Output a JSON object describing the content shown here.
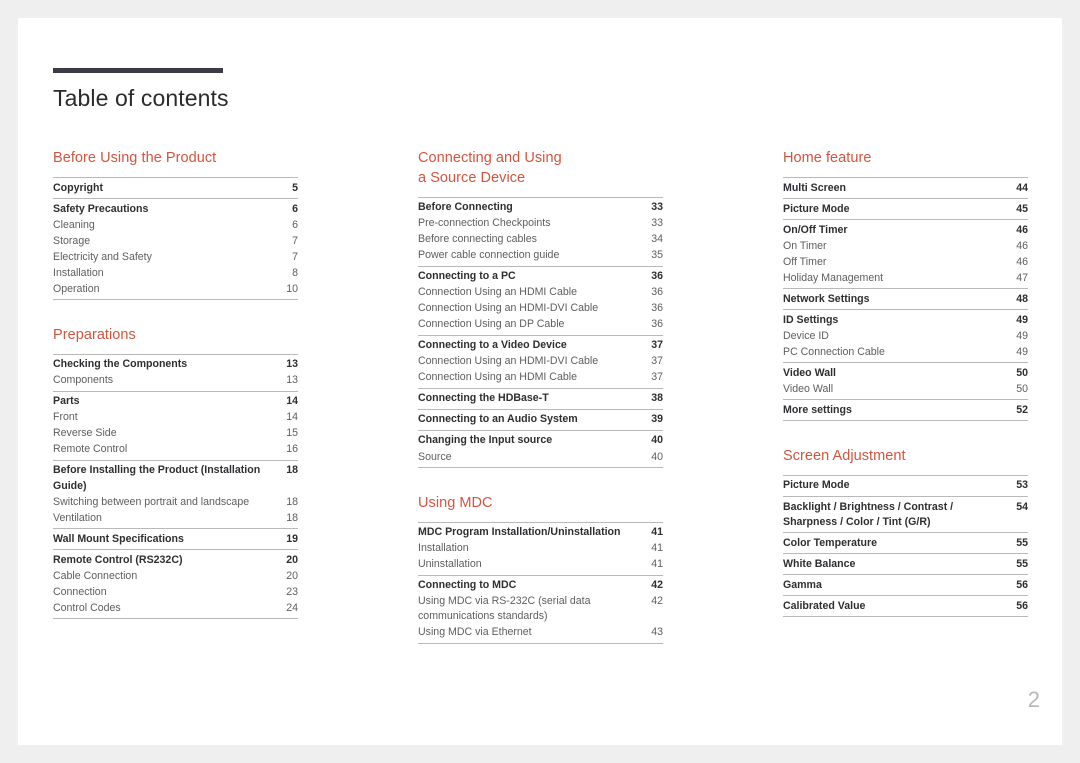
{
  "document": {
    "title": "Table of contents",
    "page_number": "2",
    "accent_color": "#cf5741",
    "rule_color": "#3c3c46"
  },
  "columns": [
    {
      "name": "left",
      "sections": [
        {
          "heading": [
            "Before Using the Product"
          ],
          "groups": [
            {
              "entries": [
                {
                  "label": "Copyright",
                  "page": "5",
                  "level": "main"
                }
              ]
            },
            {
              "entries": [
                {
                  "label": "Safety Precautions",
                  "page": "6",
                  "level": "main"
                },
                {
                  "label": "Cleaning",
                  "page": "6",
                  "level": "sub"
                },
                {
                  "label": "Storage",
                  "page": "7",
                  "level": "sub"
                },
                {
                  "label": "Electricity and Safety",
                  "page": "7",
                  "level": "sub"
                },
                {
                  "label": "Installation",
                  "page": "8",
                  "level": "sub"
                },
                {
                  "label": "Operation",
                  "page": "10",
                  "level": "sub"
                }
              ]
            }
          ]
        },
        {
          "heading": [
            "Preparations"
          ],
          "groups": [
            {
              "entries": [
                {
                  "label": "Checking the Components",
                  "page": "13",
                  "level": "main"
                },
                {
                  "label": "Components",
                  "page": "13",
                  "level": "sub"
                }
              ]
            },
            {
              "entries": [
                {
                  "label": "Parts",
                  "page": "14",
                  "level": "main"
                },
                {
                  "label": "Front",
                  "page": "14",
                  "level": "sub"
                },
                {
                  "label": "Reverse Side",
                  "page": "15",
                  "level": "sub"
                },
                {
                  "label": "Remote Control",
                  "page": "16",
                  "level": "sub"
                }
              ]
            },
            {
              "entries": [
                {
                  "label": "Before Installing the Product (Installation Guide)",
                  "page": "18",
                  "level": "main",
                  "wrap": true
                },
                {
                  "label": "Switching between portrait and landscape",
                  "page": "18",
                  "level": "sub"
                },
                {
                  "label": "Ventilation",
                  "page": "18",
                  "level": "sub"
                }
              ]
            },
            {
              "entries": [
                {
                  "label": "Wall Mount Specifications",
                  "page": "19",
                  "level": "main"
                }
              ]
            },
            {
              "entries": [
                {
                  "label": "Remote Control (RS232C)",
                  "page": "20",
                  "level": "main"
                },
                {
                  "label": "Cable Connection",
                  "page": "20",
                  "level": "sub"
                },
                {
                  "label": "Connection",
                  "page": "23",
                  "level": "sub"
                },
                {
                  "label": "Control Codes",
                  "page": "24",
                  "level": "sub"
                }
              ]
            }
          ]
        }
      ]
    },
    {
      "name": "middle",
      "sections": [
        {
          "heading": [
            "Connecting and Using",
            "a Source Device"
          ],
          "groups": [
            {
              "entries": [
                {
                  "label": "Before Connecting",
                  "page": "33",
                  "level": "main"
                },
                {
                  "label": "Pre-connection Checkpoints",
                  "page": "33",
                  "level": "sub"
                },
                {
                  "label": "Before connecting cables",
                  "page": "34",
                  "level": "sub"
                },
                {
                  "label": "Power cable connection guide",
                  "page": "35",
                  "level": "sub"
                }
              ]
            },
            {
              "entries": [
                {
                  "label": "Connecting to a PC",
                  "page": "36",
                  "level": "main"
                },
                {
                  "label": "Connection Using an HDMI Cable",
                  "page": "36",
                  "level": "sub"
                },
                {
                  "label": "Connection Using an HDMI-DVI Cable",
                  "page": "36",
                  "level": "sub"
                },
                {
                  "label": "Connection Using an DP Cable",
                  "page": "36",
                  "level": "sub"
                }
              ]
            },
            {
              "entries": [
                {
                  "label": "Connecting to a Video Device",
                  "page": "37",
                  "level": "main"
                },
                {
                  "label": "Connection Using an HDMI-DVI Cable",
                  "page": "37",
                  "level": "sub"
                },
                {
                  "label": "Connection Using an HDMI Cable",
                  "page": "37",
                  "level": "sub"
                }
              ]
            },
            {
              "entries": [
                {
                  "label": "Connecting the HDBase-T",
                  "page": "38",
                  "level": "main"
                }
              ]
            },
            {
              "entries": [
                {
                  "label": "Connecting to an Audio System",
                  "page": "39",
                  "level": "main"
                }
              ]
            },
            {
              "entries": [
                {
                  "label": "Changing the Input source",
                  "page": "40",
                  "level": "main"
                },
                {
                  "label": "Source",
                  "page": "40",
                  "level": "sub"
                }
              ]
            }
          ]
        },
        {
          "heading": [
            "Using MDC"
          ],
          "groups": [
            {
              "entries": [
                {
                  "label": "MDC Program Installation/Uninstallation",
                  "page": "41",
                  "level": "main"
                },
                {
                  "label": "Installation",
                  "page": "41",
                  "level": "sub"
                },
                {
                  "label": "Uninstallation",
                  "page": "41",
                  "level": "sub"
                }
              ]
            },
            {
              "entries": [
                {
                  "label": "Connecting to MDC",
                  "page": "42",
                  "level": "main"
                },
                {
                  "label": "Using MDC via RS-232C (serial data communications standards)",
                  "page": "42",
                  "level": "sub",
                  "wrap": true
                },
                {
                  "label": "Using MDC via Ethernet",
                  "page": "43",
                  "level": "sub"
                }
              ]
            }
          ]
        }
      ]
    },
    {
      "name": "right",
      "sections": [
        {
          "heading": [
            "Home feature"
          ],
          "groups": [
            {
              "entries": [
                {
                  "label": "Multi Screen",
                  "page": "44",
                  "level": "main"
                }
              ]
            },
            {
              "entries": [
                {
                  "label": "Picture Mode",
                  "page": "45",
                  "level": "main"
                }
              ]
            },
            {
              "entries": [
                {
                  "label": "On/Off Timer",
                  "page": "46",
                  "level": "main"
                },
                {
                  "label": "On Timer",
                  "page": "46",
                  "level": "sub"
                },
                {
                  "label": "Off Timer",
                  "page": "46",
                  "level": "sub"
                },
                {
                  "label": "Holiday Management",
                  "page": "47",
                  "level": "sub"
                }
              ]
            },
            {
              "entries": [
                {
                  "label": "Network Settings",
                  "page": "48",
                  "level": "main"
                }
              ]
            },
            {
              "entries": [
                {
                  "label": "ID Settings",
                  "page": "49",
                  "level": "main"
                },
                {
                  "label": "Device ID",
                  "page": "49",
                  "level": "sub"
                },
                {
                  "label": "PC Connection Cable",
                  "page": "49",
                  "level": "sub"
                }
              ]
            },
            {
              "entries": [
                {
                  "label": "Video Wall",
                  "page": "50",
                  "level": "main"
                },
                {
                  "label": "Video Wall",
                  "page": "50",
                  "level": "sub"
                }
              ]
            },
            {
              "entries": [
                {
                  "label": "More settings",
                  "page": "52",
                  "level": "main"
                }
              ]
            }
          ]
        },
        {
          "heading": [
            "Screen Adjustment"
          ],
          "groups": [
            {
              "entries": [
                {
                  "label": "Picture Mode",
                  "page": "53",
                  "level": "main"
                }
              ]
            },
            {
              "entries": [
                {
                  "label": "Backlight / Brightness / Contrast / Sharpness / Color / Tint (G/R)",
                  "page": "54",
                  "level": "main",
                  "wrap": true
                }
              ]
            },
            {
              "entries": [
                {
                  "label": "Color Temperature",
                  "page": "55",
                  "level": "main"
                }
              ]
            },
            {
              "entries": [
                {
                  "label": "White Balance",
                  "page": "55",
                  "level": "main"
                }
              ]
            },
            {
              "entries": [
                {
                  "label": "Gamma",
                  "page": "56",
                  "level": "main"
                }
              ]
            },
            {
              "entries": [
                {
                  "label": "Calibrated Value",
                  "page": "56",
                  "level": "main"
                }
              ]
            }
          ]
        }
      ]
    }
  ]
}
